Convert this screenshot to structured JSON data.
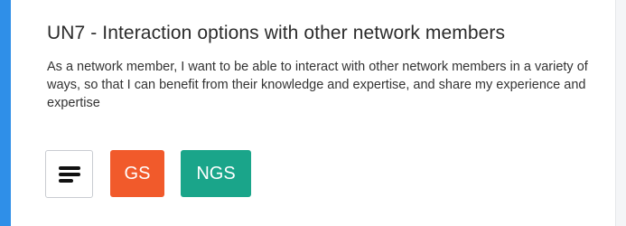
{
  "story": {
    "title": "UN7 - Interaction options with other network members",
    "description": "As a network member, I want to be able to interact with other network members in a variety of ways, so that I can benefit from their knowledge and expertise, and share my experience and expertise"
  },
  "actions": {
    "menu_icon": "menu-lines-icon",
    "tags": [
      {
        "label": "GS",
        "color": "#f15a2b"
      },
      {
        "label": "NGS",
        "color": "#1aa58a"
      }
    ]
  },
  "colors": {
    "accent": "#2f8fe8",
    "page_background": "#f4f5f7",
    "card_background": "#ffffff"
  }
}
